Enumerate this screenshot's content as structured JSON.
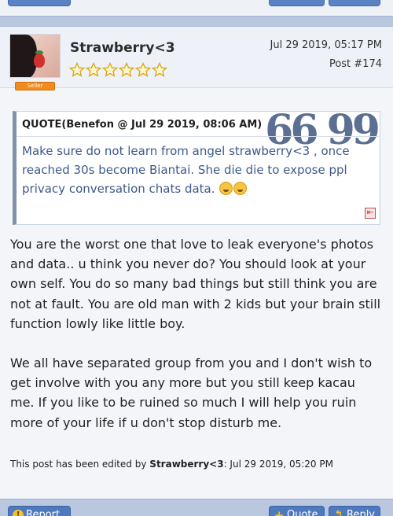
{
  "post": {
    "username": "Strawberry<3",
    "user_badge": "Seller",
    "date": "Jul 29 2019, 05:17 PM",
    "post_number": "Post #174",
    "star_count": 6
  },
  "quote": {
    "header": "QUOTE(Benefon @ Jul 29 2019, 08:06 AM)",
    "marks": "66 99",
    "body": "Make sure do not learn from angel strawberry<3 , once reached 30s become Biantai. She die die to expose ppl privacy conversation chats data."
  },
  "body": {
    "paragraph_1": "You are the worst one that love to leak everyone's photos and data.. u think you never do? You should look at your own self. You do so many bad things but still think you are not at fault. You are old man with 2 kids but your brain still function lowly like little boy.",
    "paragraph_2": "We all have separated group from you and I don't wish to get involve with you any more but you still keep kacau me. If you like to be ruined so much I will help you ruin more of your life if u don't stop disturb me."
  },
  "edit_note": {
    "prefix": "This post has been edited by",
    "editor": "Strawberry<3",
    "timestamp": ": Jul 29 2019, 05:20 PM"
  },
  "footer": {
    "report_label": "Report",
    "quote_label": "Quote",
    "reply_label": "Reply"
  },
  "colors": {
    "header_bar": "#b9c8df",
    "button_blue": "#4f79bd",
    "quote_text": "#3d5a8a",
    "badge_orange": "#f08b1e"
  }
}
